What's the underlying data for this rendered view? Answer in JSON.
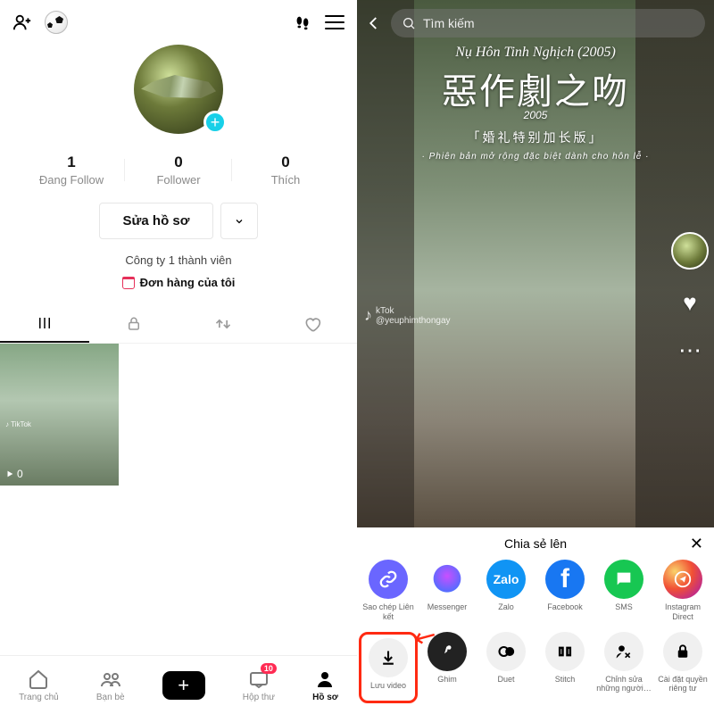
{
  "left": {
    "stats": [
      {
        "num": "1",
        "label": "Đang Follow"
      },
      {
        "num": "0",
        "label": "Follower"
      },
      {
        "num": "0",
        "label": "Thích"
      }
    ],
    "edit_label": "Sửa hồ sơ",
    "company": "Công ty 1 thành viên",
    "orders": "Đơn hàng của tôi",
    "thumb_views": "0",
    "nav": {
      "home": "Trang chủ",
      "friends": "Bạn bè",
      "inbox": "Hộp thư",
      "inbox_badge": "10",
      "profile": "Hồ sơ"
    }
  },
  "right": {
    "search_placeholder": "Tìm kiếm",
    "overlay": {
      "line1": "Nụ Hôn Tinh Nghịch (2005)",
      "line2": "惡作劇之吻",
      "year": "2005",
      "line3": "「婚礼特别加长版」",
      "line4": "· Phiên bản mở rộng đặc biệt dành cho hôn lễ ·"
    },
    "watermark_handle": "@yeuphimthongay",
    "sheet": {
      "title": "Chia sẻ lên",
      "row1": [
        {
          "id": "copy-link",
          "label": "Sao chép Liên kết"
        },
        {
          "id": "messenger",
          "label": "Messenger"
        },
        {
          "id": "zalo",
          "label": "Zalo"
        },
        {
          "id": "facebook",
          "label": "Facebook"
        },
        {
          "id": "sms",
          "label": "SMS"
        },
        {
          "id": "ig-direct",
          "label": "Instagram Direct"
        }
      ],
      "row2": [
        {
          "id": "save-video",
          "label": "Lưu video"
        },
        {
          "id": "pin",
          "label": "Ghim"
        },
        {
          "id": "duet",
          "label": "Duet"
        },
        {
          "id": "stitch",
          "label": "Stitch"
        },
        {
          "id": "edit-people",
          "label": "Chỉnh sửa những người…"
        },
        {
          "id": "privacy",
          "label": "Cài đặt quyền riêng tư"
        }
      ]
    }
  }
}
